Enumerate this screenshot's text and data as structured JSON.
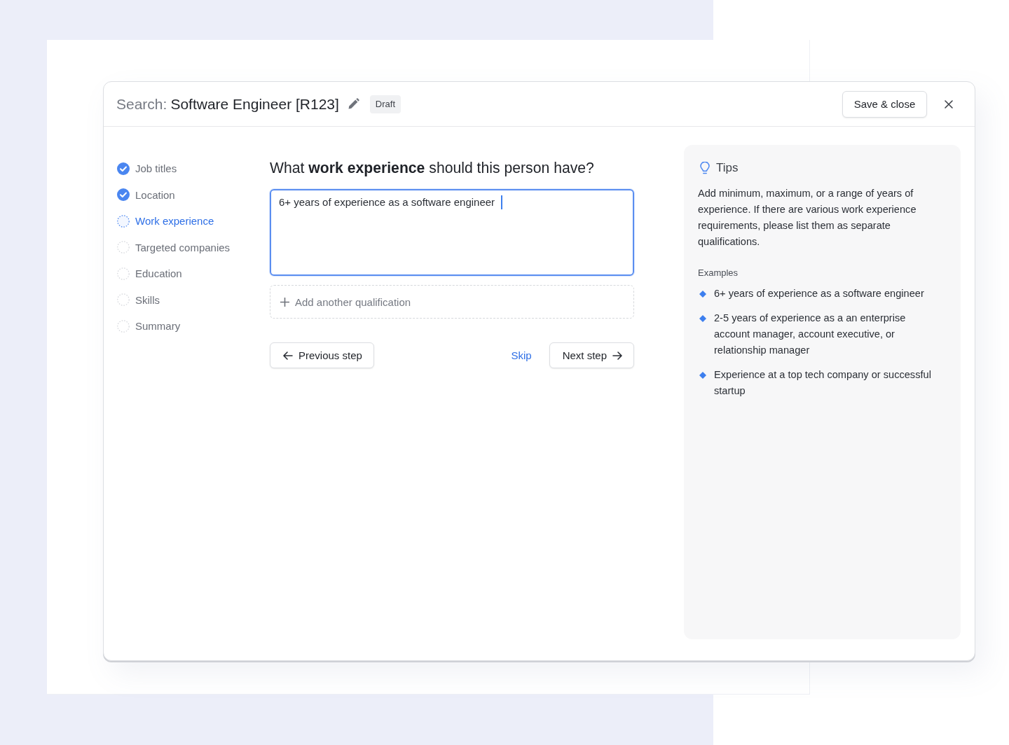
{
  "header": {
    "search_label": "Search:",
    "title": "Software Engineer [R123]",
    "status_badge": "Draft",
    "save_button": "Save & close"
  },
  "steps": [
    {
      "label": "Job titles",
      "completed": true,
      "selected": false
    },
    {
      "label": "Location",
      "completed": true,
      "selected": false
    },
    {
      "label": "Work experience",
      "completed": false,
      "selected": true
    },
    {
      "label": "Targeted companies",
      "completed": false,
      "selected": false
    },
    {
      "label": "Education",
      "completed": false,
      "selected": false
    },
    {
      "label": "Skills",
      "completed": false,
      "selected": false
    },
    {
      "label": "Summary",
      "completed": false,
      "selected": false
    }
  ],
  "question": "What **work experience** should this person have?",
  "answer_field": {
    "value": "6+ years of experience as a software engineer",
    "focused": true
  },
  "add_button": "Add another qualification",
  "navigation": {
    "previous": "Previous step",
    "skip": "Skip",
    "next": "Next step"
  },
  "tips": {
    "title": "Tips",
    "body": "Add minimum, maximum, or a range of years of experience. If there are various work experience requirements, please list them as separate qualifications.",
    "examples_label": "Examples",
    "examples": [
      "6+ years of experience as a software engineer",
      "2-5 years of experience as a an enterprise account manager, account executive, or relationship manager",
      "Experience at a top tech company or successful startup"
    ]
  }
}
